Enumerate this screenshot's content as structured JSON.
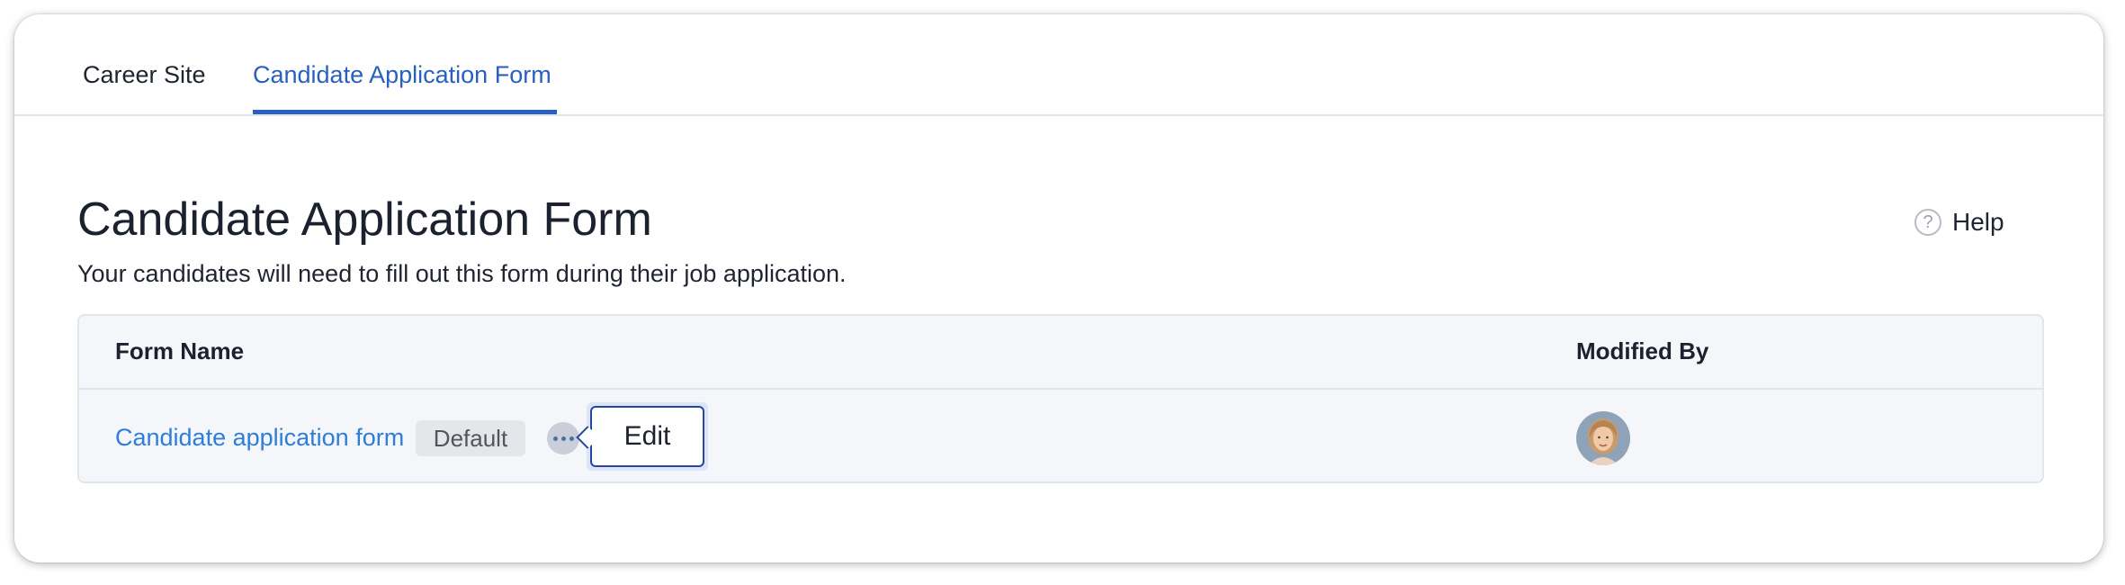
{
  "tabs": [
    {
      "label": "Career Site",
      "active": false
    },
    {
      "label": "Candidate Application Form",
      "active": true
    }
  ],
  "header": {
    "title": "Candidate Application Form",
    "subtitle": "Your candidates will need to fill out this form during their job application.",
    "help_label": "Help",
    "help_icon": "question-circle-icon"
  },
  "table": {
    "columns": [
      "Form Name",
      "Modified By"
    ],
    "rows": [
      {
        "form_name": "Candidate application form",
        "badge": "Default",
        "menu_icon": "more-horizontal-icon",
        "tooltip": "Edit",
        "modified_by_avatar": "user-avatar"
      }
    ]
  },
  "colors": {
    "accent": "#2a5fbf",
    "link": "#2d7ed8",
    "table_bg": "#f4f6fa"
  }
}
